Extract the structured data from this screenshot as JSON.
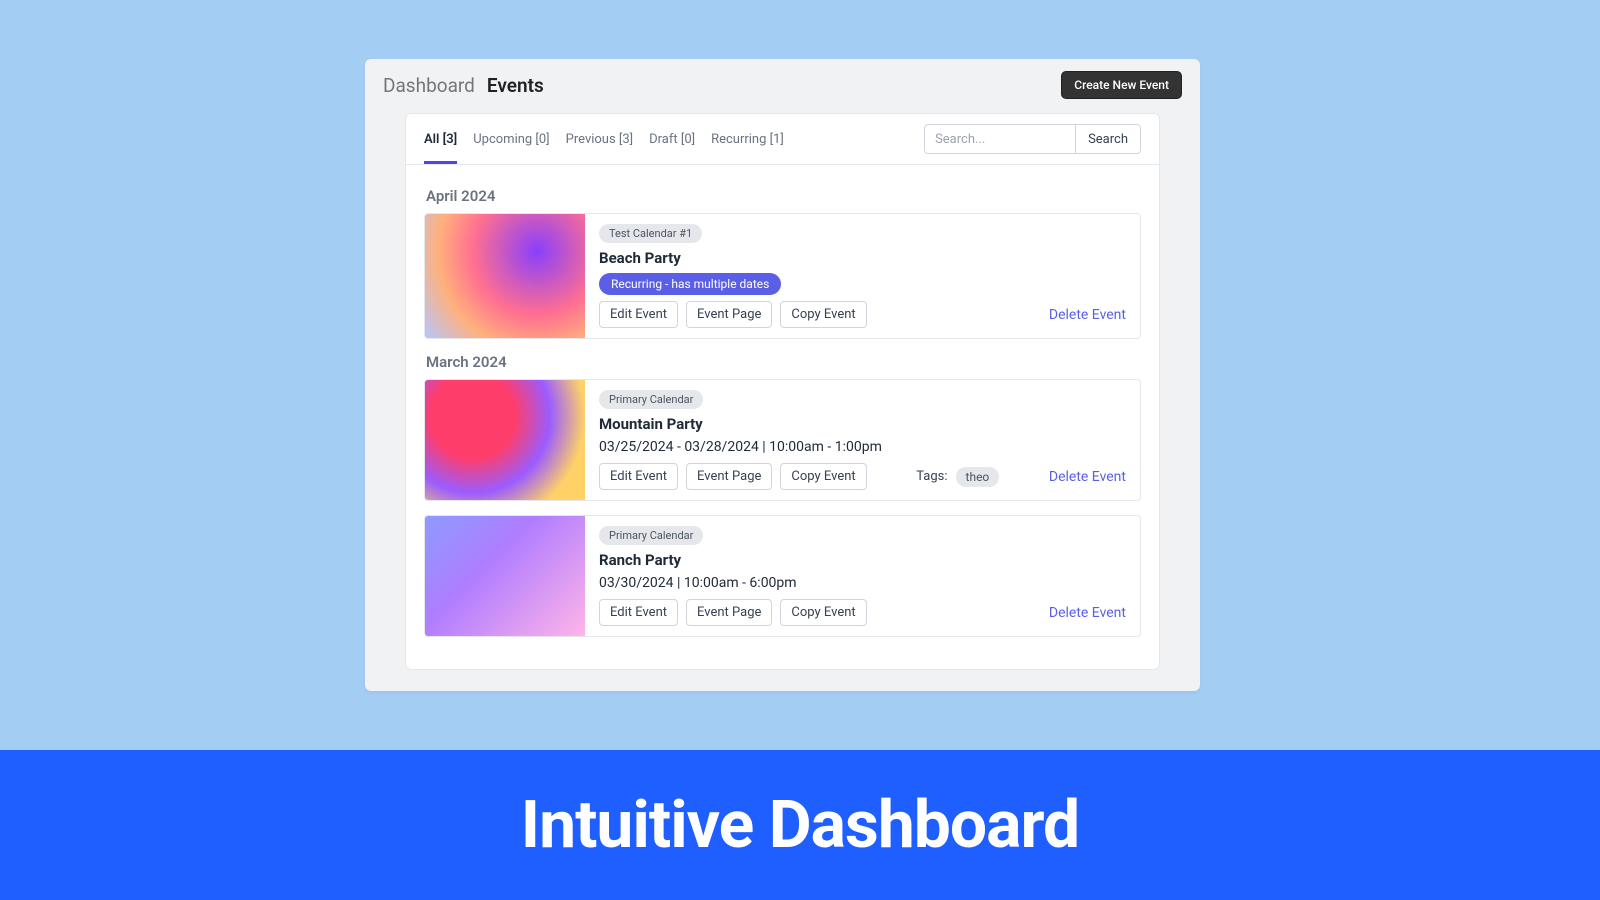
{
  "breadcrumb": {
    "item1": "Dashboard",
    "item2": "Events"
  },
  "header": {
    "create_label": "Create New Event"
  },
  "tabs": {
    "all": "All [3]",
    "upcoming": "Upcoming [0]",
    "previous": "Previous [3]",
    "draft": "Draft [0]",
    "recurring": "Recurring [1]"
  },
  "search": {
    "placeholder": "Search...",
    "button": "Search"
  },
  "months": {
    "april": "April 2024",
    "march": "March 2024"
  },
  "events": {
    "beach": {
      "calendar": "Test Calendar #1",
      "title": "Beach Party",
      "recurring_badge": "Recurring - has multiple dates"
    },
    "mountain": {
      "calendar": "Primary Calendar",
      "title": "Mountain Party",
      "subtitle": "03/25/2024 - 03/28/2024 | 10:00am - 1:00pm",
      "tags_label": "Tags:",
      "tag1": "theo"
    },
    "ranch": {
      "calendar": "Primary Calendar",
      "title": "Ranch Party",
      "subtitle": "03/30/2024 | 10:00am - 6:00pm"
    }
  },
  "buttons": {
    "edit": "Edit Event",
    "page": "Event Page",
    "copy": "Copy Event",
    "delete": "Delete Event"
  },
  "banner": {
    "text": "Intuitive Dashboard"
  }
}
